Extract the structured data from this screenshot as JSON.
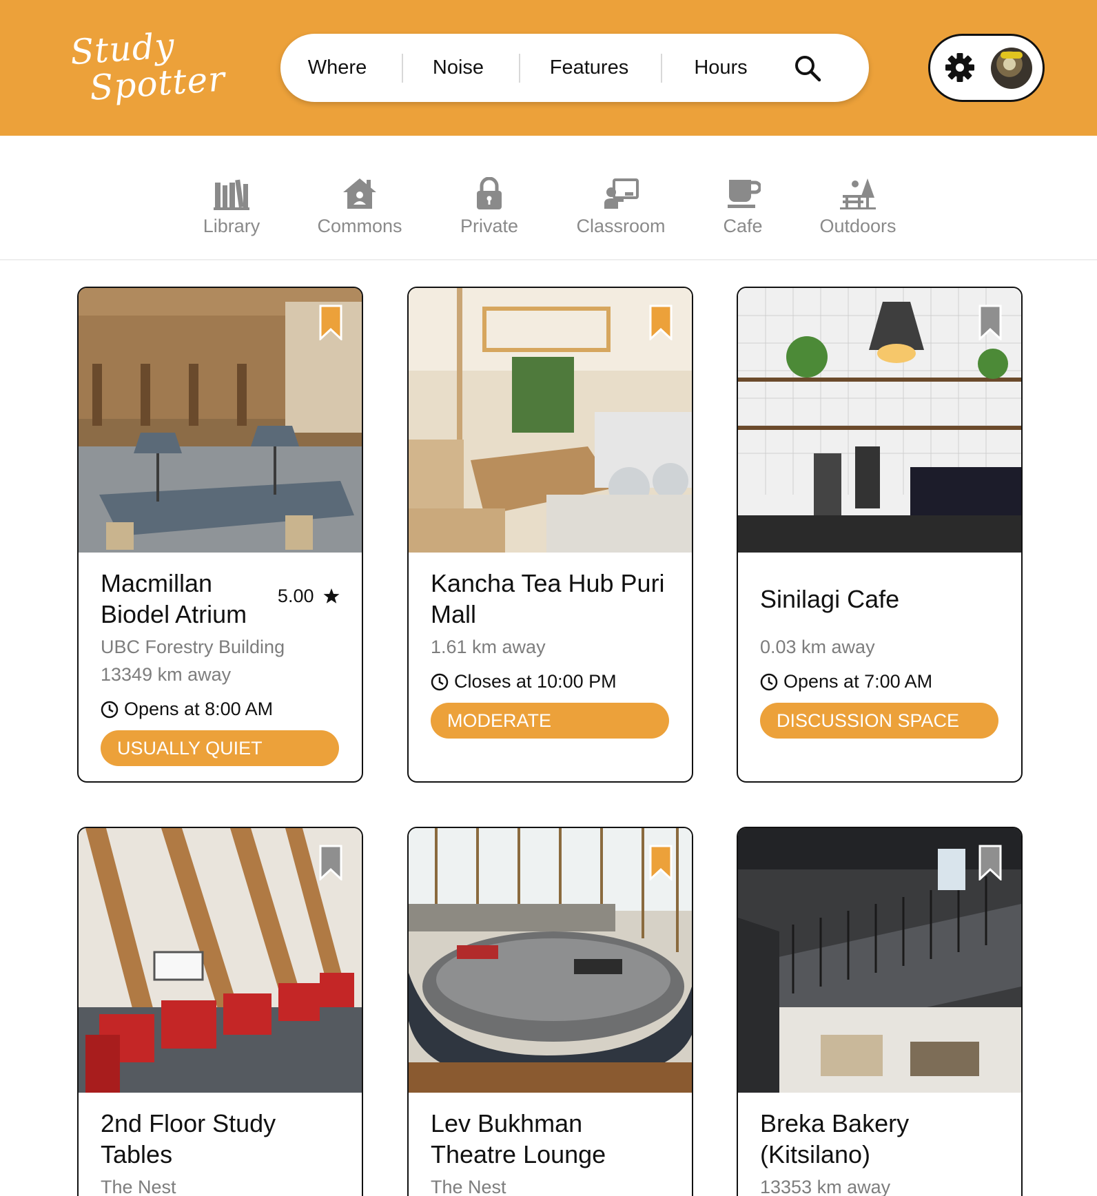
{
  "brand": {
    "logo_line1": "Study",
    "logo_line2": "Spotter",
    "accent_color": "#ECA13A"
  },
  "search_bar": {
    "where_label": "Where",
    "noise_label": "Noise",
    "features_label": "Features",
    "hours_label": "Hours",
    "search_icon": "search-icon"
  },
  "user_menu": {
    "settings_icon": "gear-icon",
    "avatar": "user-avatar"
  },
  "categories": [
    {
      "label": "Library",
      "icon": "books-icon"
    },
    {
      "label": "Commons",
      "icon": "house-icon"
    },
    {
      "label": "Private",
      "icon": "lock-icon"
    },
    {
      "label": "Classroom",
      "icon": "presentation-icon"
    },
    {
      "label": "Cafe",
      "icon": "coffee-cup-icon"
    },
    {
      "label": "Outdoors",
      "icon": "picnic-icon"
    }
  ],
  "places": [
    {
      "title": "Macmillan Biodel Atrium",
      "rating": "5.00",
      "location": "UBC Forestry Building",
      "distance": "13349 km away",
      "hours": "Opens at 8:00 AM",
      "tag": "USUALLY QUIET",
      "bookmarked": true
    },
    {
      "title": "Kancha Tea Hub Puri Mall",
      "distance": "1.61 km away",
      "hours": "Closes at 10:00 PM",
      "tag": "MODERATE",
      "bookmarked": true
    },
    {
      "title": "Sinilagi Cafe",
      "distance": "0.03 km away",
      "hours": "Opens at 7:00 AM",
      "tag": "DISCUSSION SPACE",
      "bookmarked": false
    },
    {
      "title": "2nd Floor Study Tables",
      "location": "The Nest",
      "bookmarked": false
    },
    {
      "title": "Lev Bukhman Theatre Lounge",
      "location": "The Nest",
      "bookmarked": true
    },
    {
      "title": "Breka Bakery (Kitsilano)",
      "distance": "13353 km away",
      "bookmarked": false
    }
  ]
}
